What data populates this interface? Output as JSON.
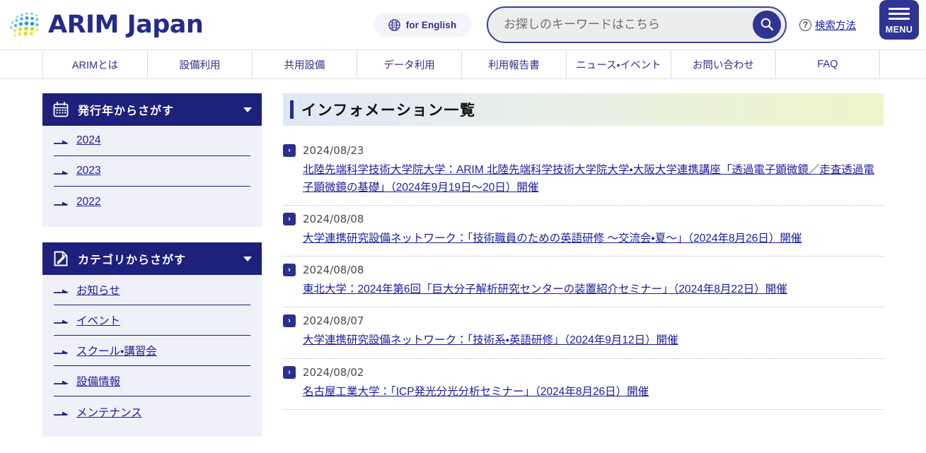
{
  "header": {
    "brand_name": "ARIM Japan",
    "brand_icon": "globe-dots-logo",
    "lang_button": {
      "label": "for English",
      "icon": "globe-icon"
    },
    "search": {
      "placeholder": "お探しのキーワードはこちら",
      "value": "",
      "button_icon": "search-icon"
    },
    "help_link": {
      "label": "検索方法",
      "icon": "question-circle-icon"
    },
    "menu_button": {
      "label": "MENU",
      "icon": "hamburger-icon"
    },
    "accent_color": "#2f3392"
  },
  "gnav": {
    "items": [
      {
        "label": "ARIMとは"
      },
      {
        "label": "設備利用"
      },
      {
        "label": "共用設備"
      },
      {
        "label": "データ利用"
      },
      {
        "label": "利用報告書"
      },
      {
        "label": "ニュース・イベント"
      },
      {
        "label": "お問い合わせ"
      },
      {
        "label": "FAQ"
      }
    ]
  },
  "sidebar": {
    "widgets": [
      {
        "title": "発行年からさがす",
        "icon": "calendar-icon",
        "caret": "chevron-down-icon",
        "links": [
          {
            "label": "2024"
          },
          {
            "label": "2023"
          },
          {
            "label": "2022"
          }
        ]
      },
      {
        "title": "カテゴリからさがす",
        "icon": "document-edit-icon",
        "caret": "chevron-down-icon",
        "links": [
          {
            "label": "お知らせ"
          },
          {
            "label": "イベント"
          },
          {
            "label": "スクール・講習会"
          },
          {
            "label": "設備情報"
          },
          {
            "label": "メンテナンス"
          }
        ]
      }
    ]
  },
  "main": {
    "page_title": "インフォメーション一覧",
    "items": [
      {
        "badge": "›",
        "date": "2024/08/23",
        "title": "北陸先端科学技術大学院大学：ARIM 北陸先端科学技術大学院大学・大阪大学連携講座「透過電子顕微鏡／走査透過電子顕微鏡の基礎」（2024年9月19日〜20日）開催"
      },
      {
        "badge": "›",
        "date": "2024/08/08",
        "title": "大学連携研究設備ネットワーク：「技術職員のための英語研修 〜交流会・夏〜」（2024年8月26日）開催"
      },
      {
        "badge": "›",
        "date": "2024/08/08",
        "title": "東北大学：2024年第6回「巨大分子解析研究センターの装置紹介セミナー」（2024年8月22日）開催"
      },
      {
        "badge": "›",
        "date": "2024/08/07",
        "title": "大学連携研究設備ネットワーク：「技術系・英語研修」（2024年9月12日）開催"
      },
      {
        "badge": "›",
        "date": "2024/08/02",
        "title": "名古屋工業大学：「ICP発光分光分析セミナー」（2024年8月26日）開催"
      }
    ]
  }
}
